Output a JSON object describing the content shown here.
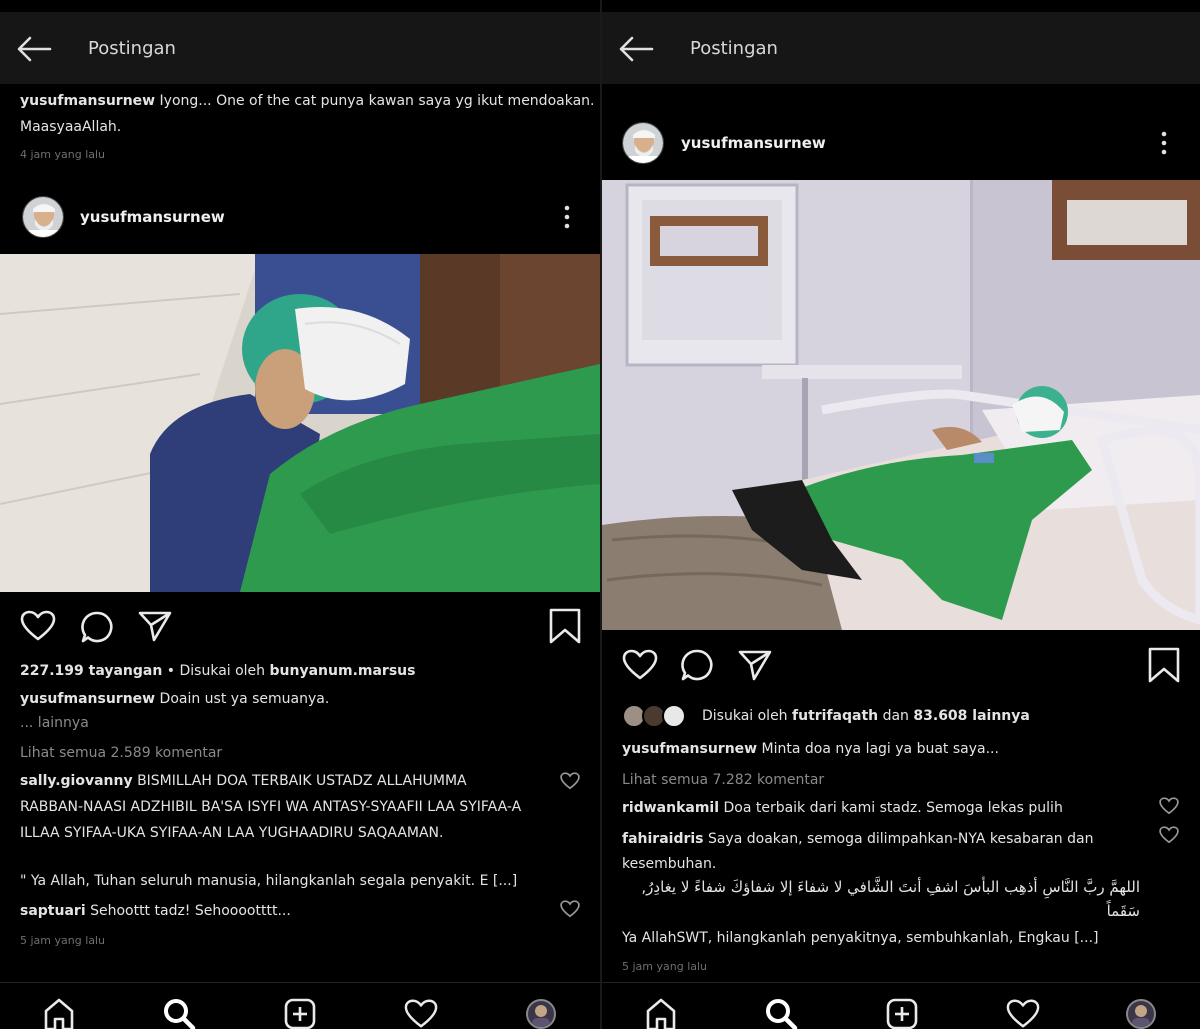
{
  "left": {
    "header": {
      "title": "Postingan"
    },
    "prev_caption": {
      "username": "yusufmansurnew",
      "text_line1": "Iyong... One of the cat punya kawan saya yg ikut mendoakan.",
      "text_line2": "MaasyaaAllah.",
      "timestamp": "4 jam yang lalu"
    },
    "post": {
      "username": "yusufmansurnew",
      "views": "227.199 tayangan",
      "liked_by_prefix": "• Disukai oleh",
      "liked_by_user": "bunyanum.marsus",
      "caption_user": "yusufmansurnew",
      "caption_text": "Doain ust ya semuanya.",
      "more": "... lainnya",
      "view_comments": "Lihat semua 2.589 komentar",
      "comments": [
        {
          "user": "sally.giovanny",
          "line1": "BISMILLAH DOA TERBAIK USTADZ ALLAHUMMA",
          "line2": "RABBAN-NAASI ADZHIBIL BA'SA ISYFI WA ANTASY-SYAAFII LAA SYIFAA-A",
          "line3": "ILLAA SYIFAA-UKA SYIFAA-AN LAA YUGHAADIRU SAQAAMAN.",
          "line4": "\" Ya Allah, Tuhan seluruh manusia, hilangkanlah segala penyakit. E [...]"
        },
        {
          "user": "saptuari",
          "text": "Sehoottt tadz! Sehooootttt..."
        }
      ],
      "timestamp": "5 jam yang lalu"
    }
  },
  "right": {
    "header": {
      "title": "Postingan"
    },
    "post": {
      "username": "yusufmansurnew",
      "liked_by_prefix": "Disukai oleh",
      "liked_by_user": "futrifaqath",
      "liked_by_and": "dan",
      "liked_by_others": "83.608 lainnya",
      "caption_user": "yusufmansurnew",
      "caption_text": "Minta doa nya lagi ya buat saya...",
      "view_comments": "Lihat semua 7.282 komentar",
      "comments": [
        {
          "user": "ridwankamil",
          "text": "Doa terbaik dari kami stadz. Semoga lekas pulih"
        },
        {
          "user": "fahiraidris",
          "line1": "Saya doakan, semoga dilimpahkan-NYA kesabaran dan",
          "line2": "kesembuhan.",
          "arabic1": "اللهمَّ ربَّ النَّاسِ أذهِب البأسَ اشفِ أنتَ الشَّافي لا شفاءَ إلا شفاؤكَ شفاءً لا يغادِرُ,",
          "arabic2": "سَقَماً",
          "line3": "Ya AllahSWT, hilangkanlah penyakitnya, sembuhkanlah, Engkau [...]"
        }
      ],
      "timestamp": "5 jam yang lalu"
    }
  },
  "icons": {
    "back": "back-arrow-icon",
    "more": "more-vertical-icon",
    "like": "heart-icon",
    "comment": "comment-icon",
    "share": "send-icon",
    "save": "bookmark-icon",
    "home": "home-icon",
    "search": "search-icon",
    "add": "add-post-icon",
    "activity": "heart-icon"
  },
  "colors": {
    "background": "#000000",
    "header_bg": "#161616",
    "text": "#e4e4e4",
    "muted": "#8a8a8a",
    "scrub_green": "#2e9a4e"
  }
}
